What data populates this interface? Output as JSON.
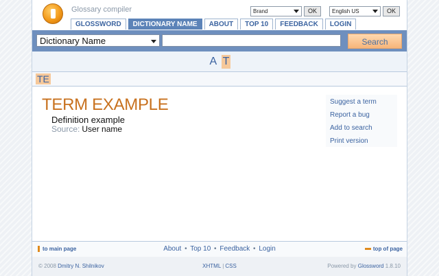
{
  "header": {
    "app_title": "Glossary compiler",
    "visual_theme_select": {
      "value": "Brand",
      "ok_label": "OK"
    },
    "language_select": {
      "value": "English US",
      "ok_label": "OK"
    }
  },
  "tabs": [
    {
      "label": "GLOSSWORD",
      "active": false
    },
    {
      "label": "DICTIONARY NAME",
      "active": true
    },
    {
      "label": "ABOUT",
      "active": false
    },
    {
      "label": "TOP 10",
      "active": false
    },
    {
      "label": "FEEDBACK",
      "active": false
    },
    {
      "label": "LOGIN",
      "active": false
    }
  ],
  "search": {
    "dictionary_select": "Dictionary Name",
    "query": "",
    "button_label": "Search"
  },
  "alphabet": {
    "letters": [
      {
        "label": "A",
        "current": false
      },
      {
        "label": "T",
        "current": true
      }
    ],
    "sub_letter": "TE"
  },
  "term": {
    "title": "TERM EXAMPLE",
    "definition": "Definition example",
    "source_label": "Source:",
    "source_value": "User name"
  },
  "side_menu": [
    "Suggest a term",
    "Report a bug",
    "Add to search",
    "Print version"
  ],
  "bottom_nav": {
    "to_main": "to main page",
    "links": [
      "About",
      "Top 10",
      "Feedback",
      "Login"
    ],
    "separator": "•",
    "top_of_page": "top of page"
  },
  "footer": {
    "copyright": "© 2008",
    "author": "Dmitry N. Shilnikov",
    "validators": [
      "XHTML",
      "CSS"
    ],
    "validators_sep": "|",
    "powered_by": "Powered by",
    "brand": "Glossword",
    "version": "1.8.10"
  },
  "colors": {
    "accent": "#5c83b8",
    "search_bar": "#6e8fbe",
    "term_title": "#c8711e",
    "highlight": "#f6c89a",
    "link": "#3a62a0"
  }
}
